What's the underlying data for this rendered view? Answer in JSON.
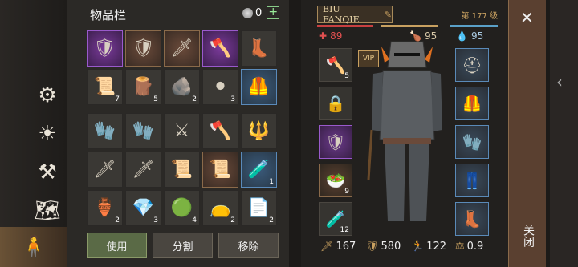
{
  "inventory": {
    "title": "物品栏",
    "coins": "0",
    "rows_a": [
      [
        {
          "icon": "🛡",
          "q": "purple",
          "count": ""
        },
        {
          "icon": "🛡",
          "q": "brown",
          "count": ""
        },
        {
          "icon": "🗡",
          "q": "brown",
          "count": ""
        },
        {
          "icon": "🪓",
          "q": "purple",
          "count": ""
        },
        {
          "icon": "👢",
          "q": "",
          "count": ""
        }
      ],
      [
        {
          "icon": "📜",
          "q": "",
          "count": "7"
        },
        {
          "icon": "🪵",
          "q": "",
          "count": "5"
        },
        {
          "icon": "🪨",
          "q": "",
          "count": "2"
        },
        {
          "icon": "⚫",
          "q": "",
          "count": "3"
        },
        {
          "icon": "🦺",
          "q": "blue",
          "count": ""
        }
      ]
    ],
    "rows_b": [
      [
        {
          "icon": "🧤",
          "q": "",
          "count": ""
        },
        {
          "icon": "🧤",
          "q": "",
          "count": ""
        },
        {
          "icon": "⚔",
          "q": "",
          "count": ""
        },
        {
          "icon": "🪓",
          "q": "",
          "count": ""
        },
        {
          "icon": "🔱",
          "q": "",
          "count": ""
        }
      ],
      [
        {
          "icon": "🗡",
          "q": "",
          "count": ""
        },
        {
          "icon": "🗡",
          "q": "",
          "count": ""
        },
        {
          "icon": "📜",
          "q": "",
          "count": ""
        },
        {
          "icon": "📜",
          "q": "brown",
          "count": ""
        },
        {
          "icon": "🧪",
          "q": "blue",
          "count": "1"
        }
      ],
      [
        {
          "icon": "🏺",
          "q": "",
          "count": "2"
        },
        {
          "icon": "💎",
          "q": "",
          "count": "3"
        },
        {
          "icon": "🟢",
          "q": "",
          "count": "4"
        },
        {
          "icon": "👝",
          "q": "",
          "count": "2"
        },
        {
          "icon": "📄",
          "q": "",
          "count": "2"
        }
      ]
    ],
    "use_label": "使用",
    "split_label": "分割",
    "remove_label": "移除"
  },
  "character": {
    "name": "BIU FANQIE",
    "level": "第 177 级",
    "health": "89",
    "food": "95",
    "water": "95",
    "vip": "VIP",
    "left_slots": [
      {
        "icon": "🪓",
        "q": "",
        "count": "5"
      },
      {
        "icon": "🔒",
        "q": "",
        "count": ""
      },
      {
        "icon": "🛡",
        "q": "purple",
        "count": ""
      },
      {
        "icon": "🥗",
        "q": "brown",
        "count": "9"
      },
      {
        "icon": "🧪",
        "q": "",
        "count": "12"
      }
    ],
    "right_slots": [
      {
        "icon": "⛑",
        "q": "blue"
      },
      {
        "icon": "🦺",
        "q": "blue"
      },
      {
        "icon": "🧤",
        "q": "blue"
      },
      {
        "icon": "👖",
        "q": "blue"
      },
      {
        "icon": "👢",
        "q": "blue"
      }
    ],
    "damage": "167",
    "armor": "580",
    "speed": "122",
    "weight": "0.9"
  },
  "close_label": "关闭",
  "colors": {
    "health": "#c84040",
    "food": "#c8a060",
    "water": "#5aa0c8"
  }
}
